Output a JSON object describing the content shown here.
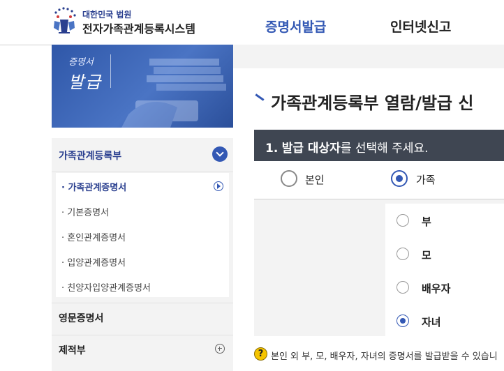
{
  "header": {
    "logo_sub": "대한민국 법원",
    "logo_title": "전자가족관계등록시스템",
    "nav": [
      {
        "label": "증명서발급",
        "active": true
      },
      {
        "label": "인터넷신고",
        "active": false
      }
    ]
  },
  "banner": {
    "line1": "증명서",
    "line2": "발급"
  },
  "sidebar": {
    "section_title": "가족관계등록부",
    "sub_items": [
      {
        "label": "· 가족관계증명서",
        "active": true
      },
      {
        "label": "· 기본증명서",
        "active": false
      },
      {
        "label": "· 혼인관계증명서",
        "active": false
      },
      {
        "label": "· 입양관계증명서",
        "active": false
      },
      {
        "label": "· 친양자입양관계증명서",
        "active": false
      }
    ],
    "rows": [
      {
        "label": "영문증명서"
      },
      {
        "label": "제적부"
      }
    ]
  },
  "main": {
    "page_title": "가족관계등록부 열람/발급 신",
    "step": {
      "number": "1.",
      "bold": "발급 대상자",
      "rest": "를 선택해 주세요."
    },
    "target_options": [
      {
        "label": "본인",
        "selected": false
      },
      {
        "label": "가족",
        "selected": true
      }
    ],
    "family_options": [
      {
        "label": "부",
        "selected": false
      },
      {
        "label": "모",
        "selected": false
      },
      {
        "label": "배우자",
        "selected": false
      },
      {
        "label": "자녀",
        "selected": true
      }
    ],
    "notice": "본인 외 부, 모, 배우자, 자녀의 증명서를 발급받을 수 있습니"
  },
  "colors": {
    "accent": "#3358b4",
    "step_bar": "#3f4652",
    "panel_gray": "#f3f3f3"
  }
}
